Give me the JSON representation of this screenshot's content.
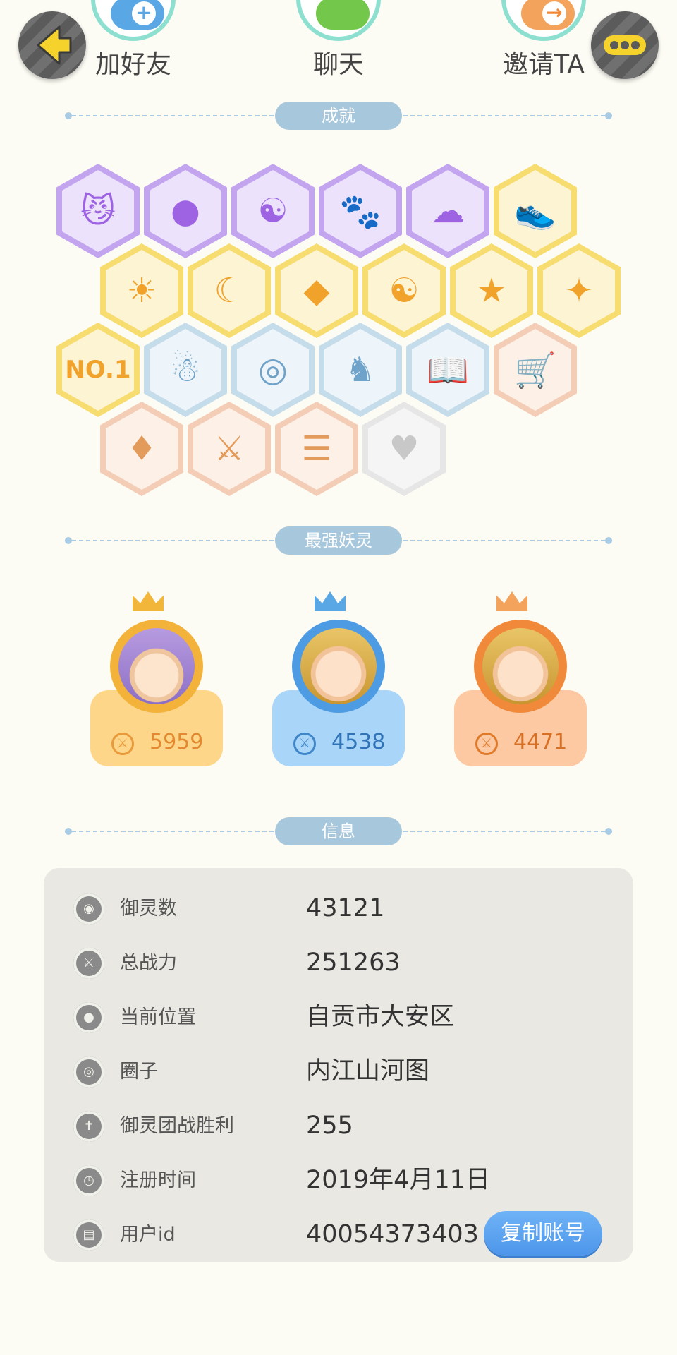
{
  "top_actions": [
    {
      "label": "加好友"
    },
    {
      "label": "聊天"
    },
    {
      "label": "邀请TA"
    }
  ],
  "icons": {
    "back": "arrow-left-icon",
    "more": "more-dots-icon"
  },
  "sections": {
    "achievements": "成就",
    "strongest_spirits": "最强妖灵",
    "info": "信息"
  },
  "achievements": {
    "badges": [
      {
        "tier": "purple",
        "symbol": "😼"
      },
      {
        "tier": "purple",
        "symbol": "●"
      },
      {
        "tier": "purple",
        "symbol": "☯"
      },
      {
        "tier": "purple",
        "symbol": "🐾"
      },
      {
        "tier": "purple",
        "symbol": "☁"
      },
      {
        "tier": "gold",
        "symbol": "👟"
      },
      {
        "tier": "gold",
        "symbol": "☀"
      },
      {
        "tier": "gold",
        "symbol": "☾"
      },
      {
        "tier": "gold",
        "symbol": "◆"
      },
      {
        "tier": "gold",
        "symbol": "☯"
      },
      {
        "tier": "gold",
        "symbol": "★"
      },
      {
        "tier": "gold",
        "symbol": "✦"
      },
      {
        "tier": "gold",
        "symbol": "NO.1"
      },
      {
        "tier": "blue",
        "symbol": "☃"
      },
      {
        "tier": "blue",
        "symbol": "◎"
      },
      {
        "tier": "blue",
        "symbol": "♞"
      },
      {
        "tier": "blue",
        "symbol": "📖"
      },
      {
        "tier": "peach",
        "symbol": "🛒"
      },
      {
        "tier": "peach",
        "symbol": "♦"
      },
      {
        "tier": "peach",
        "symbol": "⚔"
      },
      {
        "tier": "peach",
        "symbol": "☰"
      },
      {
        "tier": "grey",
        "symbol": "♥"
      }
    ]
  },
  "strongest_spirits": [
    {
      "power": "5959",
      "theme": "gold"
    },
    {
      "power": "4538",
      "theme": "blue"
    },
    {
      "power": "4471",
      "theme": "orange"
    }
  ],
  "info": {
    "rows": [
      {
        "label": "御灵数",
        "value": "43121",
        "icon": "spirit-count-icon"
      },
      {
        "label": "总战力",
        "value": "251263",
        "icon": "combat-power-icon"
      },
      {
        "label": "当前位置",
        "value": "自贡市大安区",
        "icon": "location-pin-icon"
      },
      {
        "label": "圈子",
        "value": "内江山河图",
        "icon": "circle-target-icon"
      },
      {
        "label": "御灵团战胜利",
        "value": "255",
        "icon": "team-battle-icon"
      },
      {
        "label": "注册时间",
        "value": "2019年4月11日",
        "icon": "clock-icon"
      },
      {
        "label": "用户id",
        "value": "40054373403",
        "icon": "user-id-icon"
      }
    ],
    "copy_button": "复制账号"
  },
  "colors": {
    "background": "#fdfcf4",
    "section_pill": "#a7c7dc",
    "panel": "#e9e8e2",
    "copy_button": "#4c95ea"
  }
}
